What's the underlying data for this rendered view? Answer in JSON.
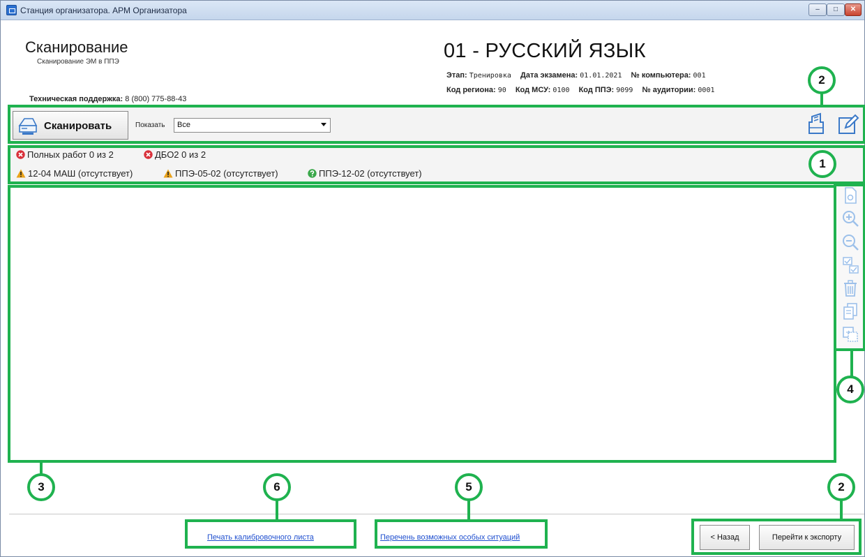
{
  "window": {
    "title": "Станция организатора. АРМ Организатора",
    "min_glyph": "‒",
    "max_glyph": "□",
    "close_glyph": "✕"
  },
  "header": {
    "title": "Сканирование",
    "subtitle": "Сканирование ЭМ в ППЭ",
    "support_label": "Техническая поддержка:",
    "support_value": "8 (800) 775-88-43",
    "subject": "01 - РУССКИЙ ЯЗЫК",
    "meta": {
      "stage_label": "Этап:",
      "stage_value": "Тренировка",
      "date_label": "Дата экзамена:",
      "date_value": "01.01.2021",
      "computer_label": "№ компьютера:",
      "computer_value": "001",
      "region_label": "Код региона:",
      "region_value": "90",
      "msu_label": "Код МСУ:",
      "msu_value": "0100",
      "ppe_label": "Код ППЭ:",
      "ppe_value": "9099",
      "room_label": "№ аудитории:",
      "room_value": "0001"
    }
  },
  "toolbar": {
    "scan_label": "Сканировать",
    "show_label": "Показать",
    "show_value": "Все",
    "icons": [
      "scanner-icon",
      "print-icon",
      "edit-icon"
    ]
  },
  "status": {
    "full_works": "Полных работ 0 из 2",
    "dbo2": "ДБО2 0 из 2",
    "mash": "12-04 МАШ (отсутствует)",
    "ppe05": "ППЭ-05-02 (отсутствует)",
    "ppe12": "ППЭ-12-02 (отсутствует)",
    "colors": {
      "error": "#d9303a",
      "warning": "#e9a21a",
      "question": "#3aa84a"
    }
  },
  "side_toolbar": {
    "icons": [
      "view-page-icon",
      "zoom-in-icon",
      "zoom-out-icon",
      "check-pages-icon",
      "trash-icon",
      "copy-pages-icon",
      "replace-page-icon"
    ]
  },
  "footer": {
    "calibration_link": "Печать калибровочного листа",
    "special_link": "Перечень возможных особых ситуаций",
    "back_label": "< Назад",
    "export_label": "Перейти к экспорту"
  },
  "annotations": {
    "color": "#1fb24f",
    "markers": [
      "1",
      "2",
      "2",
      "3",
      "4",
      "5",
      "6"
    ]
  }
}
